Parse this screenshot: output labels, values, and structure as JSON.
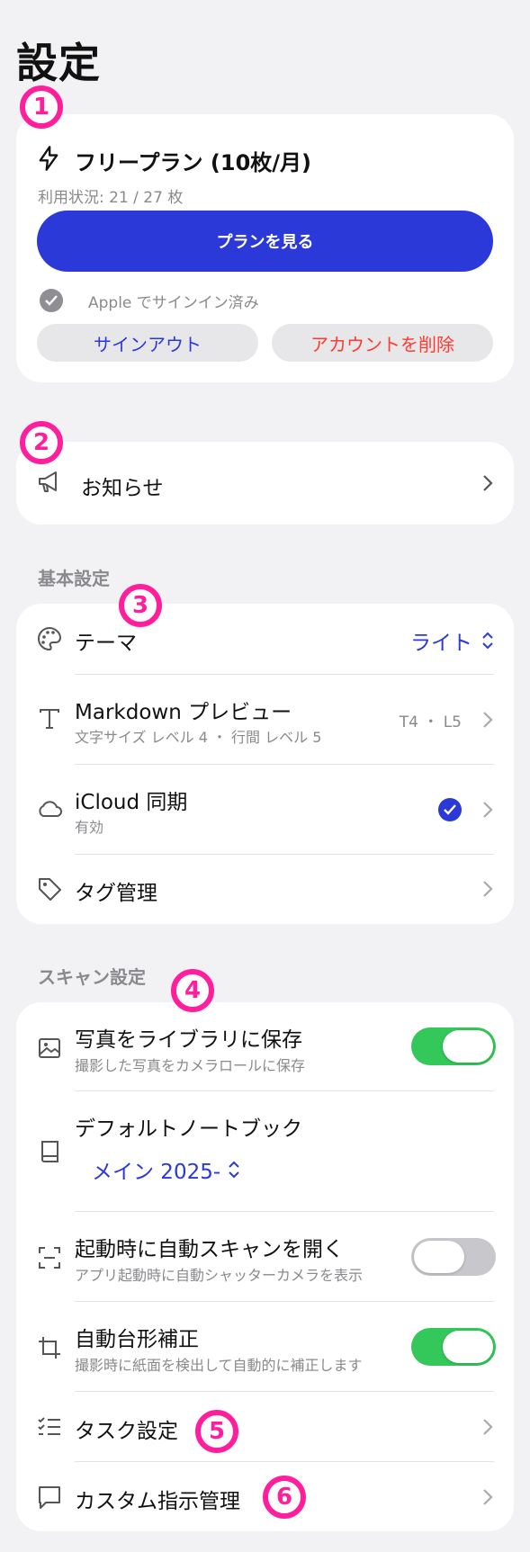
{
  "page": {
    "title": "設定"
  },
  "badges": [
    "1",
    "2",
    "3",
    "4",
    "5",
    "6"
  ],
  "plan": {
    "title": "フリープラン (10枚/月)",
    "usage": "利用状況: 21 / 27 枚",
    "view_plans_label": "プランを見る",
    "signed_in": "Apple でサインイン済み",
    "sign_out_label": "サインアウト",
    "delete_account_label": "アカウントを削除"
  },
  "notice": {
    "label": "お知らせ"
  },
  "basic": {
    "header": "基本設定",
    "theme": {
      "label": "テーマ",
      "value": "ライト"
    },
    "markdown": {
      "label": "Markdown プレビュー",
      "sub": "文字サイズ レベル 4 ・ 行間 レベル 5",
      "value": "T4 ・ L5"
    },
    "icloud": {
      "label": "iCloud 同期",
      "sub": "有効"
    },
    "tags": {
      "label": "タグ管理"
    }
  },
  "scan": {
    "header": "スキャン設定",
    "save_photos": {
      "label": "写真をライブラリに保存",
      "sub": "撮影した写真をカメラロールに保存",
      "enabled": true
    },
    "default_notebook": {
      "label": "デフォルトノートブック",
      "value": "メイン 2025-"
    },
    "auto_scan": {
      "label": "起動時に自動スキャンを開く",
      "sub": "アプリ起動時に自動シャッターカメラを表示",
      "enabled": false
    },
    "auto_crop": {
      "label": "自動台形補正",
      "sub": "撮影時に紙面を検出して自動的に補正します",
      "enabled": true
    },
    "task": {
      "label": "タスク設定"
    },
    "custom": {
      "label": "カスタム指示管理"
    }
  },
  "colors": {
    "accent": "#2a39d8",
    "danger": "#ff3b30",
    "toggle_on": "#34c759",
    "badge": "#ff1f9c"
  }
}
